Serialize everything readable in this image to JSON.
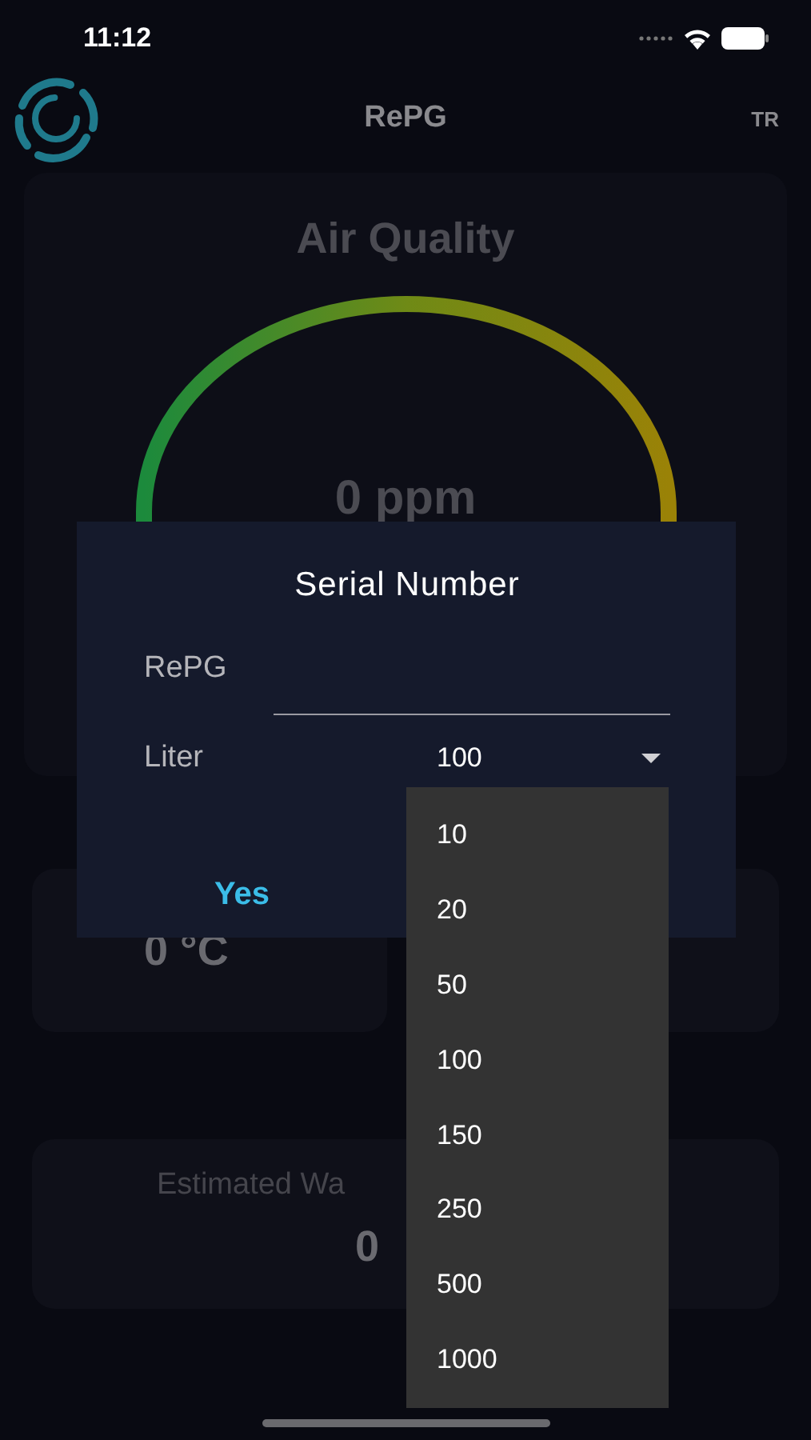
{
  "status_bar": {
    "time": "11:12"
  },
  "header": {
    "title": "RePG",
    "language": "TR"
  },
  "air_quality": {
    "title": "Air Quality",
    "reading": "0 ppm"
  },
  "temperature": {
    "reading": "0 °C"
  },
  "estimated_water": {
    "label": "Estimated Wa",
    "reading": "0"
  },
  "dialog": {
    "title": "Serial Number",
    "fields": [
      {
        "kind": "text",
        "label": "RePG"
      },
      {
        "kind": "select",
        "label": "Liter",
        "value": "100",
        "expanded": true
      }
    ],
    "buttons": [
      "Yes"
    ]
  },
  "dropdown": {
    "options": [
      "10",
      "20",
      "50",
      "100",
      "150",
      "250",
      "500",
      "1000"
    ]
  }
}
